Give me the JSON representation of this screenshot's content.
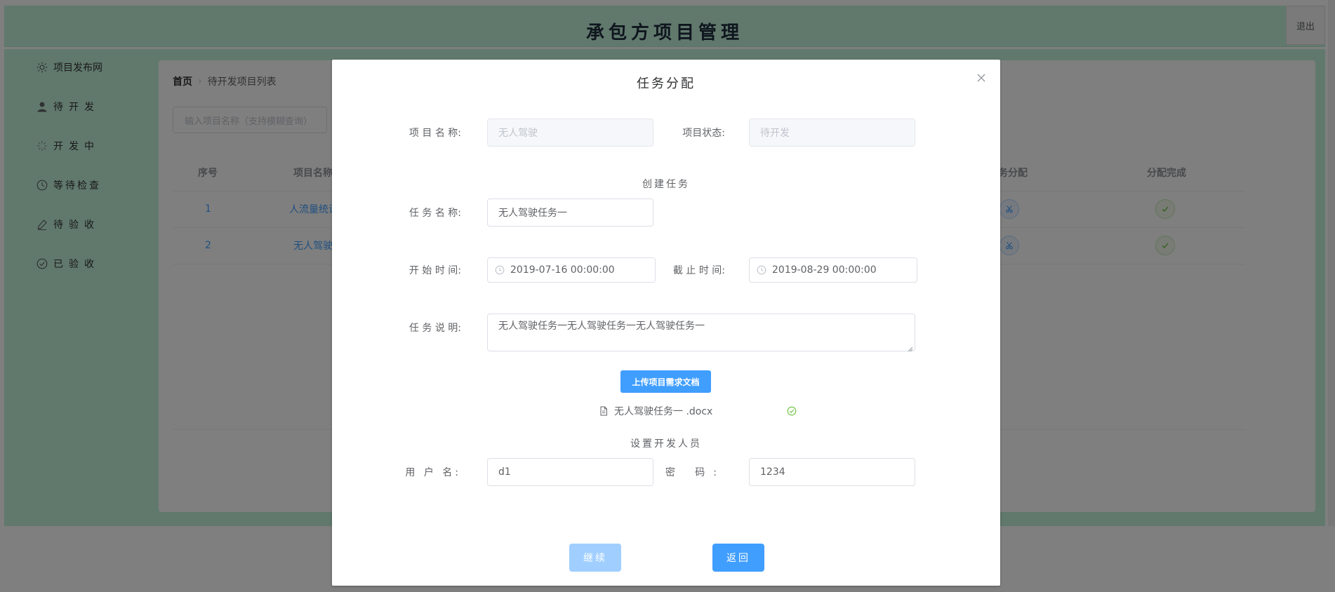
{
  "app": {
    "title": "承包方项目管理",
    "logout_label": "退出"
  },
  "sidebar": {
    "items": [
      {
        "label": "项目发布网",
        "icon": "sun-icon"
      },
      {
        "label": "待开发",
        "icon": "user-icon"
      },
      {
        "label": "开发中",
        "icon": "loading-icon"
      },
      {
        "label": "等待检查",
        "icon": "clock-icon"
      },
      {
        "label": "待验收",
        "icon": "edit-icon"
      },
      {
        "label": "已验收",
        "icon": "check-circle-icon"
      }
    ]
  },
  "breadcrumb": {
    "home": "首页",
    "current": "待开发项目列表"
  },
  "search": {
    "placeholder": "输入项目名称（支持模糊查询）"
  },
  "table": {
    "columns": {
      "index": "序号",
      "name": "项目名称",
      "assign": "务分配",
      "done": "分配完成"
    },
    "rows": [
      {
        "index": "1",
        "name": "人流量统计"
      },
      {
        "index": "2",
        "name": "无人驾驶"
      }
    ]
  },
  "dialog": {
    "title": "任务分配",
    "project_name_label": "项 目 名 称:",
    "project_name_value": "无人驾驶",
    "project_status_label": "项目状态:",
    "project_status_value": "待开发",
    "create_task_title": "创建任务",
    "task_name_label": "任 务 名 称:",
    "task_name_value": "无人驾驶任务一",
    "start_time_label": "开 始 时 间:",
    "start_time_value": "2019-07-16 00:00:00",
    "end_time_label": "截 止 时 间:",
    "end_time_value": "2019-08-29 00:00:00",
    "task_desc_label": "任 务 说 明:",
    "task_desc_value": "无人驾驶任务一无人驾驶任务一无人驾驶任务一",
    "upload_label": "上传项目需求文档",
    "file_name": "无人驾驶任务一 .docx",
    "developer_title": "设置开发人员",
    "username_label": "用 户 名:",
    "username_value": "d1",
    "password_label": "密 码:",
    "password_value": "1234",
    "continue_label": "继续",
    "back_label": "返回"
  },
  "colors": {
    "primary": "#409eff",
    "primary_light": "#a0cfff",
    "sidebar_bg": "#c2f3db",
    "success": "#67c23a"
  }
}
